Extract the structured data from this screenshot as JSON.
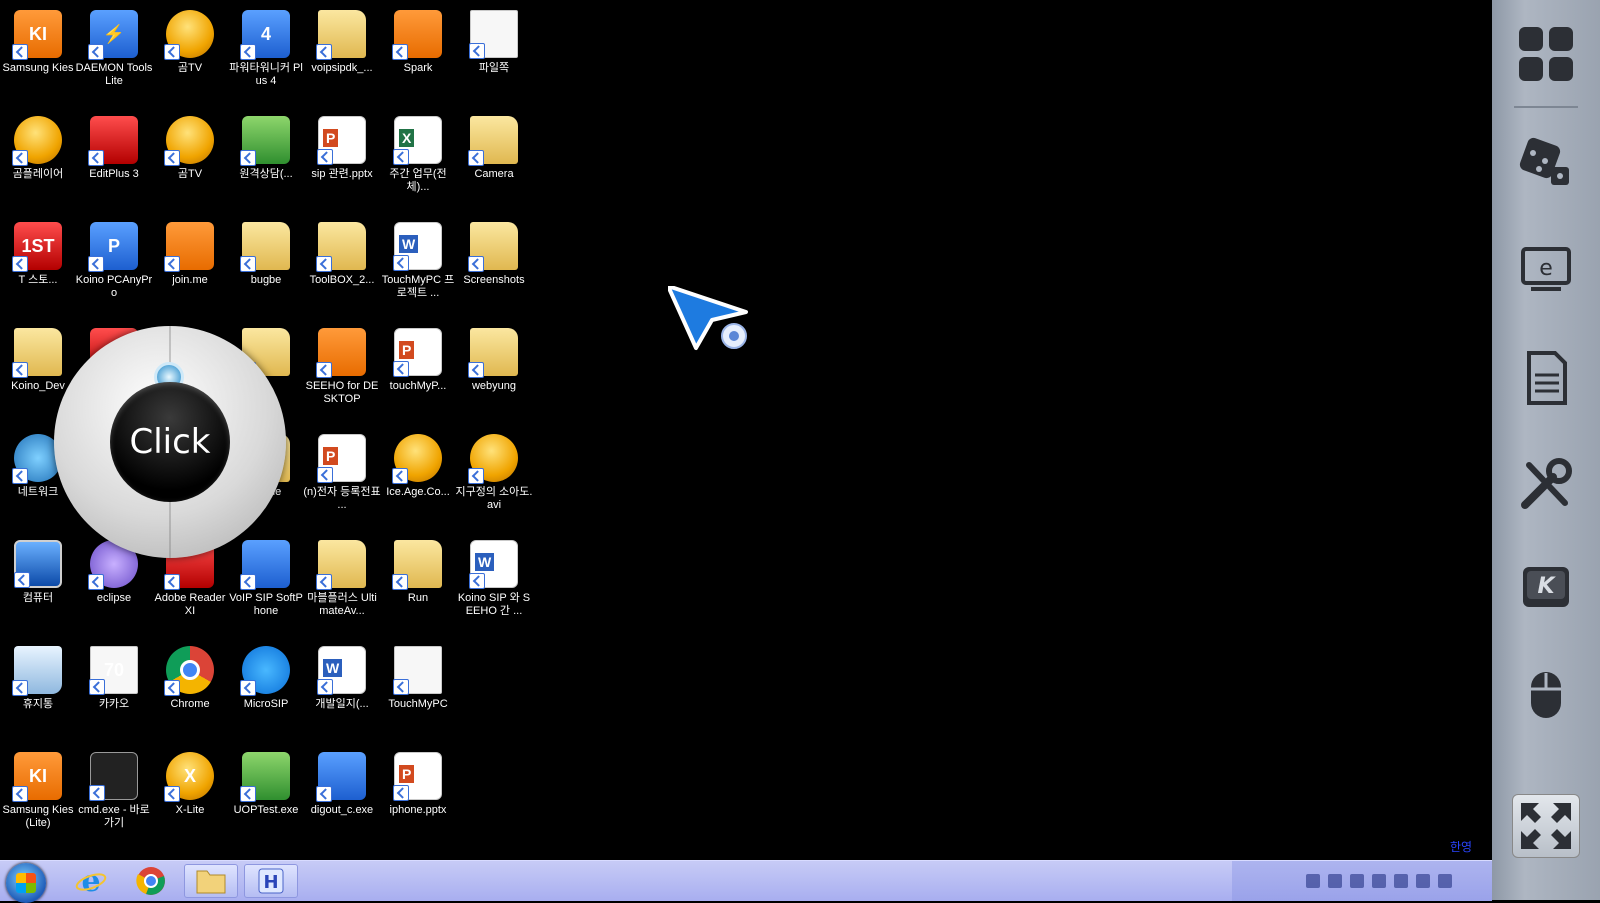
{
  "desktop_icons": [
    {
      "label": "Samsung Kies",
      "style": "orange",
      "text": "KI"
    },
    {
      "label": "DAEMON Tools Lite",
      "style": "blue",
      "text": "⚡"
    },
    {
      "label": "곰TV",
      "style": "gold",
      "text": ""
    },
    {
      "label": "파워타워니커 Plus 4",
      "style": "blue",
      "text": "4"
    },
    {
      "label": "voipsipdk_...",
      "style": "folder",
      "text": ""
    },
    {
      "label": "Spark",
      "style": "orange",
      "text": ""
    },
    {
      "label": "파일쪽",
      "style": "white-doc",
      "text": ""
    },
    {
      "label": "곰플레이어",
      "style": "gold",
      "text": ""
    },
    {
      "label": "EditPlus 3",
      "style": "red",
      "text": ""
    },
    {
      "label": "곰TV",
      "style": "gold",
      "text": ""
    },
    {
      "label": "원격상담(...",
      "style": "green",
      "text": ""
    },
    {
      "label": "sip 관련.pptx",
      "style": "ppt",
      "text": ""
    },
    {
      "label": "주간 업무(전체)...",
      "style": "excel",
      "text": ""
    },
    {
      "label": "Camera",
      "style": "folder",
      "text": ""
    },
    {
      "label": "T 스토...",
      "style": "red",
      "text": "1ST"
    },
    {
      "label": "Koino PCAnyPro",
      "style": "blue",
      "text": "P"
    },
    {
      "label": "join.me",
      "style": "orange",
      "text": ""
    },
    {
      "label": "bugbe",
      "style": "folder",
      "text": ""
    },
    {
      "label": "ToolBOX_2...",
      "style": "folder",
      "text": ""
    },
    {
      "label": "TouchMyPC 프로젝트 ...",
      "style": "word",
      "text": ""
    },
    {
      "label": "Screenshots",
      "style": "folder",
      "text": ""
    },
    {
      "label": "Koino_Dev",
      "style": "folder",
      "text": ""
    },
    {
      "label": "",
      "style": "red",
      "text": ""
    },
    {
      "label": "",
      "style": "folder",
      "text": ""
    },
    {
      "label": "SEEHO for DESKTOP",
      "style": "orange",
      "text": ""
    },
    {
      "label": "touchMyP...",
      "style": "ppt",
      "text": ""
    },
    {
      "label": "webyung",
      "style": "folder",
      "text": ""
    },
    {
      "label": "네트워크",
      "style": "teal",
      "text": ""
    },
    {
      "label": "",
      "style": "white-doc",
      "text": ""
    },
    {
      "label": "phone",
      "style": "folder",
      "text": ""
    },
    {
      "label": "(n)전자 등록전표 ...",
      "style": "ppt",
      "text": ""
    },
    {
      "label": "Ice.Age.Co...",
      "style": "gold",
      "text": ""
    },
    {
      "label": "지구정의 소아도.avi",
      "style": "gold",
      "text": ""
    },
    {
      "label": "컴퓨터",
      "style": "monitor",
      "text": ""
    },
    {
      "label": "eclipse",
      "style": "purple",
      "text": ""
    },
    {
      "label": "Adobe Reader XI",
      "style": "red",
      "text": ""
    },
    {
      "label": "VoIP SIP SoftPhone",
      "style": "blue",
      "text": ""
    },
    {
      "label": "마블플러스 UltimateAv...",
      "style": "folder",
      "text": ""
    },
    {
      "label": "Run",
      "style": "folder",
      "text": ""
    },
    {
      "label": "Koino SIP 와 SEEHO 간 ...",
      "style": "word",
      "text": ""
    },
    {
      "label": "휴지통",
      "style": "recycle",
      "text": ""
    },
    {
      "label": "카카오",
      "style": "white-doc",
      "text": "70"
    },
    {
      "label": "Chrome",
      "style": "chrome",
      "text": ""
    },
    {
      "label": "MicroSIP",
      "style": "skype-blue",
      "text": ""
    },
    {
      "label": "개발일지(...",
      "style": "word",
      "text": ""
    },
    {
      "label": "TouchMyPC",
      "style": "white-doc",
      "text": ""
    },
    {
      "label": "Samsung Kies (Lite)",
      "style": "orange",
      "text": "KI"
    },
    {
      "label": "cmd.exe - 바로 가기",
      "style": "dark",
      "text": ""
    },
    {
      "label": "X-Lite",
      "style": "gold",
      "text": "X"
    },
    {
      "label": "UOPTest.exe",
      "style": "green",
      "text": ""
    },
    {
      "label": "digout_c.exe",
      "style": "blue",
      "text": ""
    },
    {
      "label": "iphone.pptx",
      "style": "ppt",
      "text": ""
    }
  ],
  "click_widget": {
    "label": "Click"
  },
  "side_panel": {
    "buttons": [
      {
        "name": "apps-grid-icon"
      },
      {
        "name": "dice-icon"
      },
      {
        "name": "browser-e-icon"
      },
      {
        "name": "document-icon"
      },
      {
        "name": "tools-icon"
      },
      {
        "name": "keyboard-k-icon"
      },
      {
        "name": "mouse-icon"
      }
    ]
  },
  "taskbar": {
    "items": [
      {
        "name": "taskbar-ie"
      },
      {
        "name": "taskbar-chrome"
      },
      {
        "name": "taskbar-explorer"
      },
      {
        "name": "taskbar-hangul"
      }
    ],
    "tray_label": "한영"
  },
  "colors": {
    "taskbar": "#b1b6f2",
    "panel": "#9aa3b0",
    "cursor": "#1e7be0"
  }
}
